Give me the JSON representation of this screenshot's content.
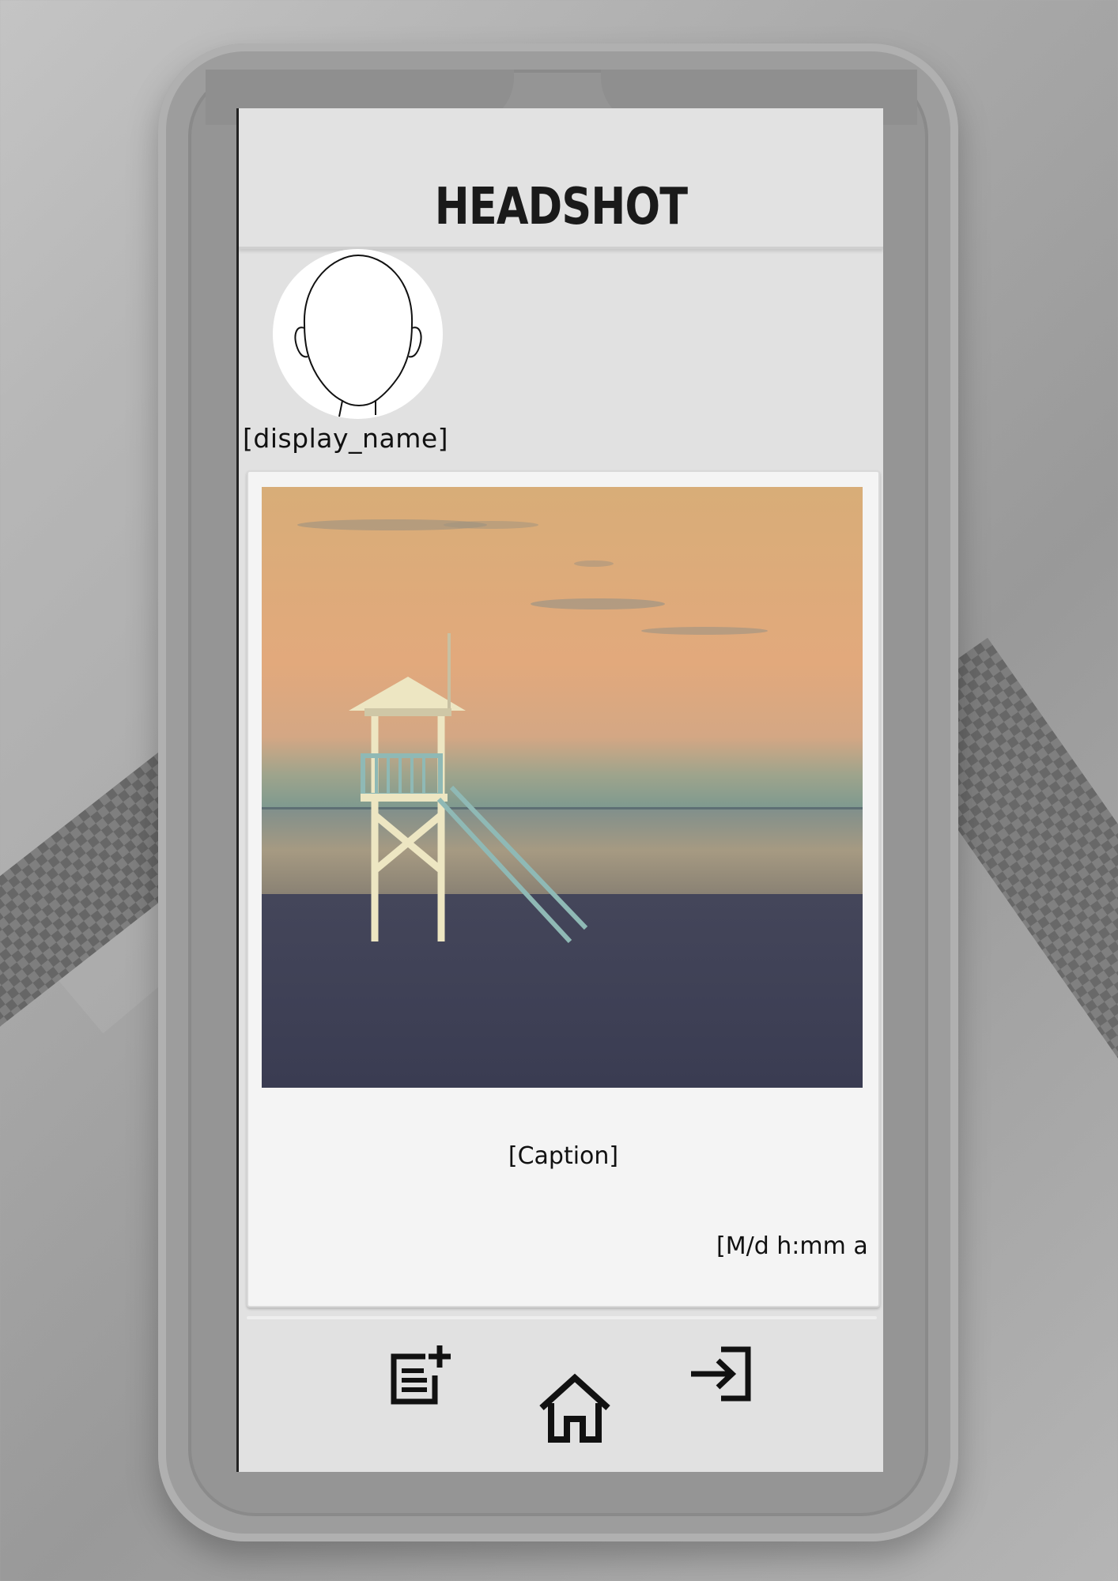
{
  "app": {
    "title": "HEADSHOT"
  },
  "profile": {
    "display_name": "[display_name]",
    "avatar_icon": "face-outline-icon"
  },
  "post": {
    "caption": "[Caption]",
    "timestamp": "[M/d h:mm a"
  },
  "nav": {
    "items": [
      {
        "icon": "new-post-icon"
      },
      {
        "icon": "home-icon"
      },
      {
        "icon": "login-icon"
      }
    ]
  },
  "colors": {
    "screen_bg": "#e1e1e1",
    "card_bg": "#f4f4f4",
    "text": "#111111"
  }
}
